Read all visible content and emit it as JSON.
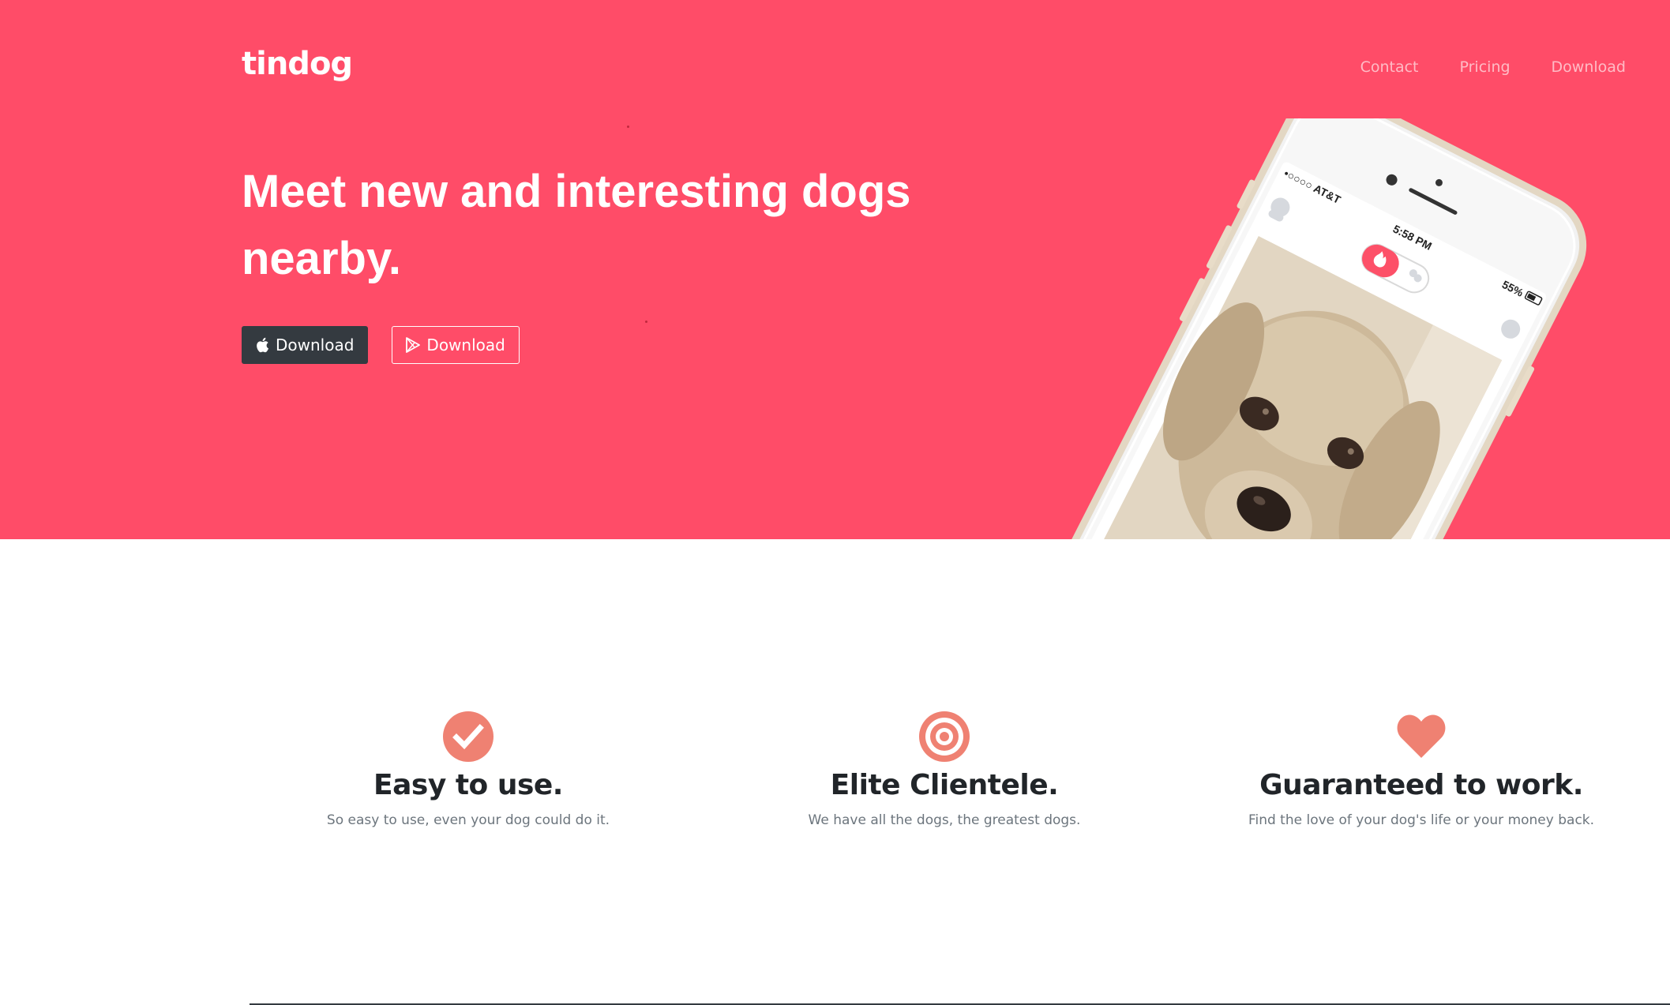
{
  "brand": "tindog",
  "nav": {
    "contact": "Contact",
    "pricing": "Pricing",
    "download": "Download"
  },
  "hero": {
    "headline": "Meet new and interesting dogs nearby.",
    "apple_button_label": "Download",
    "play_button_label": "Download"
  },
  "phone": {
    "carrier": "•○○○○ AT&T",
    "time": "5:58 PM",
    "battery": "55%"
  },
  "features": [
    {
      "icon": "check-circle-icon",
      "title": "Easy to use.",
      "text": "So easy to use, even your dog could do it."
    },
    {
      "icon": "bullseye-icon",
      "title": "Elite Clientele.",
      "text": "We have all the dogs, the greatest dogs."
    },
    {
      "icon": "heart-icon",
      "title": "Guaranteed to work.",
      "text": "Find the love of your dog's life or your money back."
    }
  ],
  "colors": {
    "hero_background": "#ff4c68",
    "icon_accent": "#ef8172",
    "dark_button": "#343a40",
    "heading_text": "#212529",
    "muted_text": "#6c757d"
  }
}
